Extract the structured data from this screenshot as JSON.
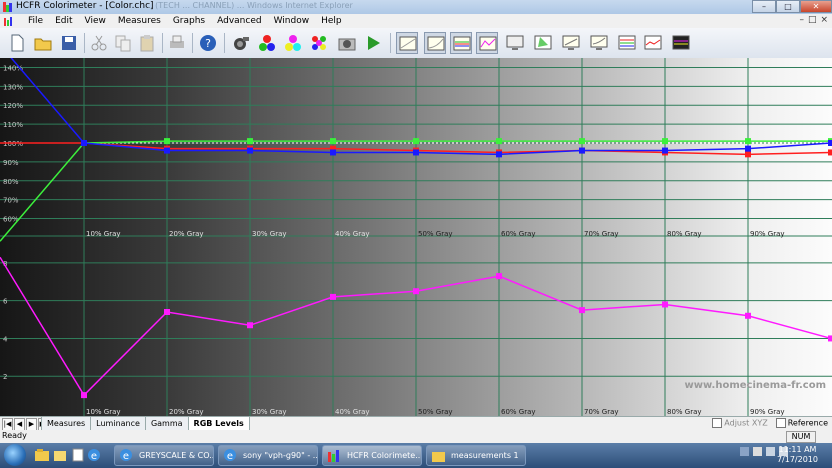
{
  "window": {
    "title": "HCFR Colorimeter - [Color.chc]",
    "title_background_ghost": "... (TECH ... CHANNEL) ... Windows Internet Explorer",
    "controls": [
      "–",
      "□",
      "✕"
    ]
  },
  "menu": {
    "items": [
      "File",
      "Edit",
      "View",
      "Measures",
      "Graphs",
      "Advanced",
      "Window",
      "Help"
    ],
    "mdi_controls": [
      "–",
      "□",
      "×"
    ]
  },
  "toolbar": {
    "buttons": [
      {
        "icon": "new-document-icon"
      },
      {
        "icon": "open-folder-icon"
      },
      {
        "icon": "save-disk-icon"
      },
      {
        "icon": "cut-icon"
      },
      {
        "icon": "copy-icon"
      },
      {
        "icon": "paste-icon"
      },
      {
        "icon": "print-icon"
      },
      {
        "icon": "help-icon"
      },
      {
        "icon": "sensor-icon"
      },
      {
        "icon": "rgb-balls-icon"
      },
      {
        "icon": "color-balls-icon"
      },
      {
        "icon": "color-grid-icon"
      },
      {
        "icon": "camera-icon"
      },
      {
        "icon": "play-icon"
      },
      {
        "icon": "graph-luminance-icon"
      },
      {
        "icon": "graph-gamma-icon"
      },
      {
        "icon": "graph-rgb-levels-icon"
      },
      {
        "icon": "graph-multi-icon"
      },
      {
        "icon": "monitor-icon"
      },
      {
        "icon": "cie-diagram-icon"
      },
      {
        "icon": "monitor-graph-icon"
      },
      {
        "icon": "monitor-graph-2-icon"
      },
      {
        "icon": "color-levels-icon"
      },
      {
        "icon": "color-temp-icon"
      },
      {
        "icon": "spectrum-icon"
      }
    ]
  },
  "chart_data": {
    "type": "line",
    "x_categories": [
      "",
      "10% Gray",
      "20% Gray",
      "30% Gray",
      "40% Gray",
      "50% Gray",
      "60% Gray",
      "70% Gray",
      "80% Gray",
      "90% Gray",
      ""
    ],
    "panels": [
      {
        "name": "rgb_levels",
        "y_ticks": [
          "140%",
          "130%",
          "120%",
          "110%",
          "100%",
          "90%",
          "80%",
          "70%",
          "60%"
        ],
        "ylim": [
          55,
          145
        ],
        "reference_line": 100,
        "series": [
          {
            "name": "red",
            "color": "#ff2020",
            "values": [
              100,
              100,
              97,
              97,
              97,
              96,
              95,
              96,
              95,
              94,
              95
            ]
          },
          {
            "name": "green",
            "color": "#3cf03c",
            "values": [
              48,
              100,
              101,
              101,
              101,
              101,
              101,
              101,
              101,
              101,
              101
            ]
          },
          {
            "name": "blue",
            "color": "#1a1aff",
            "values": [
              152,
              100,
              96,
              96,
              95,
              95,
              94,
              96,
              96,
              97,
              100
            ]
          }
        ]
      },
      {
        "name": "delta_e",
        "y_ticks": [
          "8",
          "6",
          "4",
          "2"
        ],
        "ylim": [
          0,
          9
        ],
        "series": [
          {
            "name": "delta",
            "color": "#ff1aff",
            "values": [
              8.3,
              1.0,
              5.4,
              4.7,
              6.2,
              6.5,
              7.3,
              5.5,
              5.8,
              5.2,
              4.0
            ]
          }
        ]
      }
    ],
    "watermark": "www.homecinema-fr.com"
  },
  "tabs": {
    "nav": [
      "|◀",
      "◀",
      "▶",
      "▶|"
    ],
    "items": [
      "Measures",
      "Luminance",
      "Gamma",
      "RGB Levels"
    ],
    "active": "RGB Levels",
    "adjust_xyz": "Adjust XYZ",
    "reference": "Reference"
  },
  "status": {
    "text": "Ready",
    "num": "NUM"
  },
  "taskbar": {
    "buttons": [
      {
        "label": "GREYSCALE & CO...",
        "icon": "ie-icon"
      },
      {
        "label": "sony \"vph-g90\" - ...",
        "icon": "ie-icon"
      },
      {
        "label": "HCFR Colorimete...",
        "icon": "hcfr-icon"
      },
      {
        "label": "measurements 1",
        "icon": "folder-icon"
      }
    ],
    "time": "11:11 AM",
    "date": "7/17/2010"
  }
}
